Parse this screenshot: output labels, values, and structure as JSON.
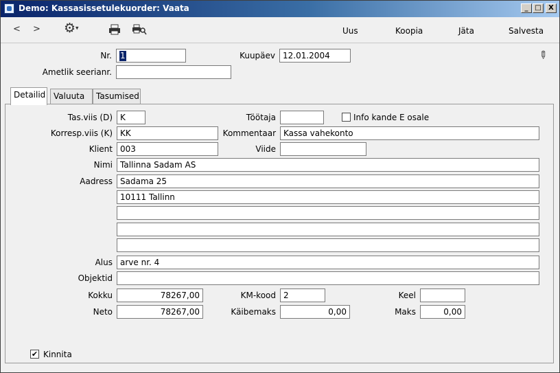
{
  "window": {
    "title": "Demo: Kassasissetulekuorder: Vaata",
    "controls": {
      "minimize": "_",
      "maximize": "□",
      "close": "X"
    }
  },
  "toolbar": {
    "back": "<",
    "forward": ">",
    "new_label": "Uus",
    "copy_label": "Koopia",
    "cancel_label": "Jäta",
    "save_label": "Salvesta"
  },
  "header": {
    "nr_label": "Nr.",
    "nr_value": "1",
    "date_label": "Kuupäev",
    "date_value": "12.01.2004",
    "official_serial_label": "Ametlik seerianr.",
    "official_serial_value": ""
  },
  "tabs": [
    {
      "label": "Detailid",
      "active": true
    },
    {
      "label": "Valuuta",
      "active": false
    },
    {
      "label": "Tasumised",
      "active": false
    }
  ],
  "details": {
    "payment_mode_label": "Tas.viis (D)",
    "payment_mode_value": "K",
    "employee_label": "Töötaja",
    "employee_value": "",
    "info_checkbox_label": "Info kande E osale",
    "info_checked": false,
    "corr_mode_label": "Korresp.viis (K)",
    "corr_mode_value": "KK",
    "comment_label": "Kommentaar",
    "comment_value": "Kassa vahekonto",
    "client_label": "Klient",
    "client_value": "003",
    "reference_label": "Viide",
    "reference_value": "",
    "name_label": "Nimi",
    "name_value": "Tallinna Sadam AS",
    "address_label": "Aadress",
    "address_lines": [
      "Sadama 25",
      "10111 Tallinn",
      "",
      "",
      ""
    ],
    "basis_label": "Alus",
    "basis_value": "arve nr. 4",
    "objects_label": "Objektid",
    "objects_value": "",
    "total_label": "Kokku",
    "total_value": "78267,00",
    "vat_code_label": "KM-kood",
    "vat_code_value": "2",
    "language_label": "Keel",
    "language_value": "",
    "net_label": "Neto",
    "net_value": "78267,00",
    "turnover_tax_label": "Käibemaks",
    "turnover_tax_value": "0,00",
    "tax_label": "Maks",
    "tax_value": "0,00"
  },
  "footer": {
    "confirm_label": "Kinnita",
    "confirm_checked": true,
    "checkmark": "✔"
  },
  "icons": {
    "settings": "gear-icon",
    "print": "printer-icon",
    "print_preview": "print-preview-icon",
    "pin": "pin-icon"
  }
}
